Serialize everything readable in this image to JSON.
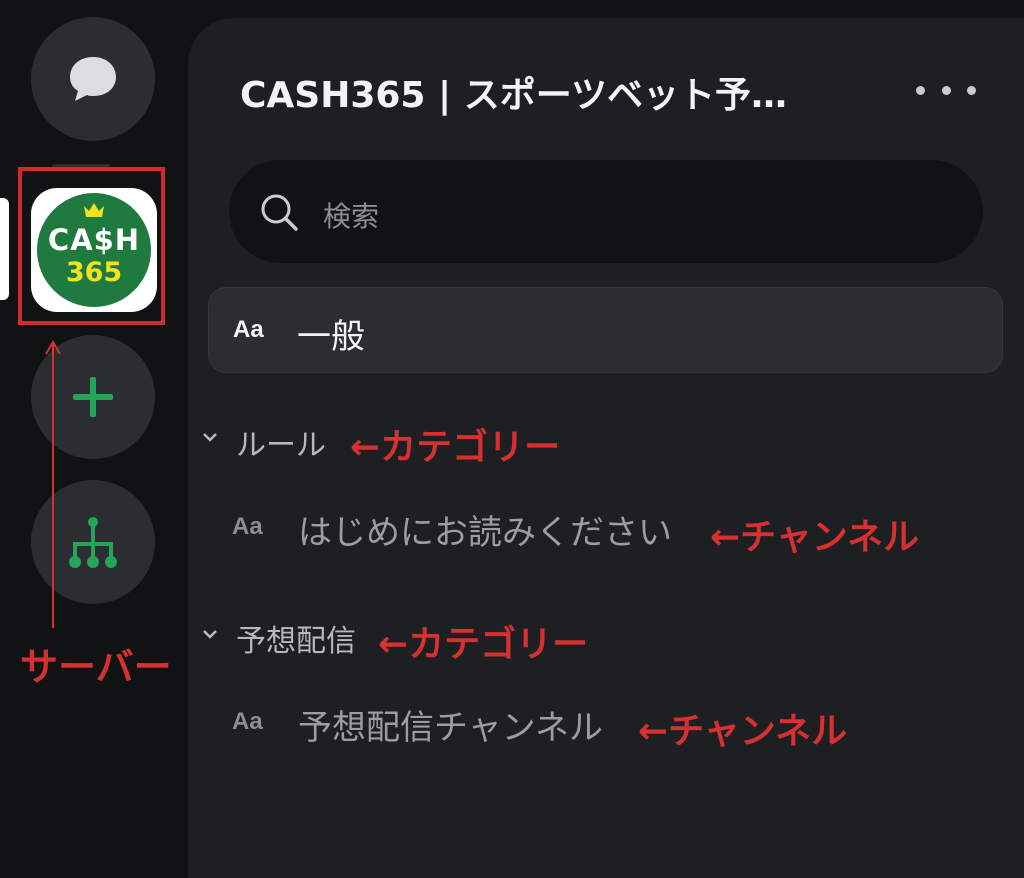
{
  "server": {
    "name": "CASH365 | スポーツベット予…",
    "logo_line1": "CA$H",
    "logo_line2": "365"
  },
  "search": {
    "placeholder": "検索"
  },
  "channels": {
    "general": {
      "prefix": "Aa",
      "label": "一般"
    }
  },
  "categories": [
    {
      "label": "ルール",
      "channel": {
        "prefix": "Aa",
        "label": "はじめにお読みください"
      }
    },
    {
      "label": "予想配信",
      "channel": {
        "prefix": "Aa",
        "label": "予想配信チャンネル"
      }
    }
  ],
  "annotations": {
    "server": "サーバー",
    "category_1": "←カテゴリー",
    "channel_1": "←チャンネル",
    "category_2": "←カテゴリー",
    "channel_2": "←チャンネル"
  },
  "icons": {
    "messages": "chat-bubble-icon",
    "add_server": "plus-icon",
    "discover": "hierarchy-icon",
    "search": "search-icon",
    "more": "more-dots-icon",
    "category": "chevron-down-icon"
  },
  "colors": {
    "accent_green": "#23a55a",
    "annotation_red": "#d63030",
    "logo_green": "#1f7a3f",
    "logo_yellow": "#f4e21a"
  }
}
